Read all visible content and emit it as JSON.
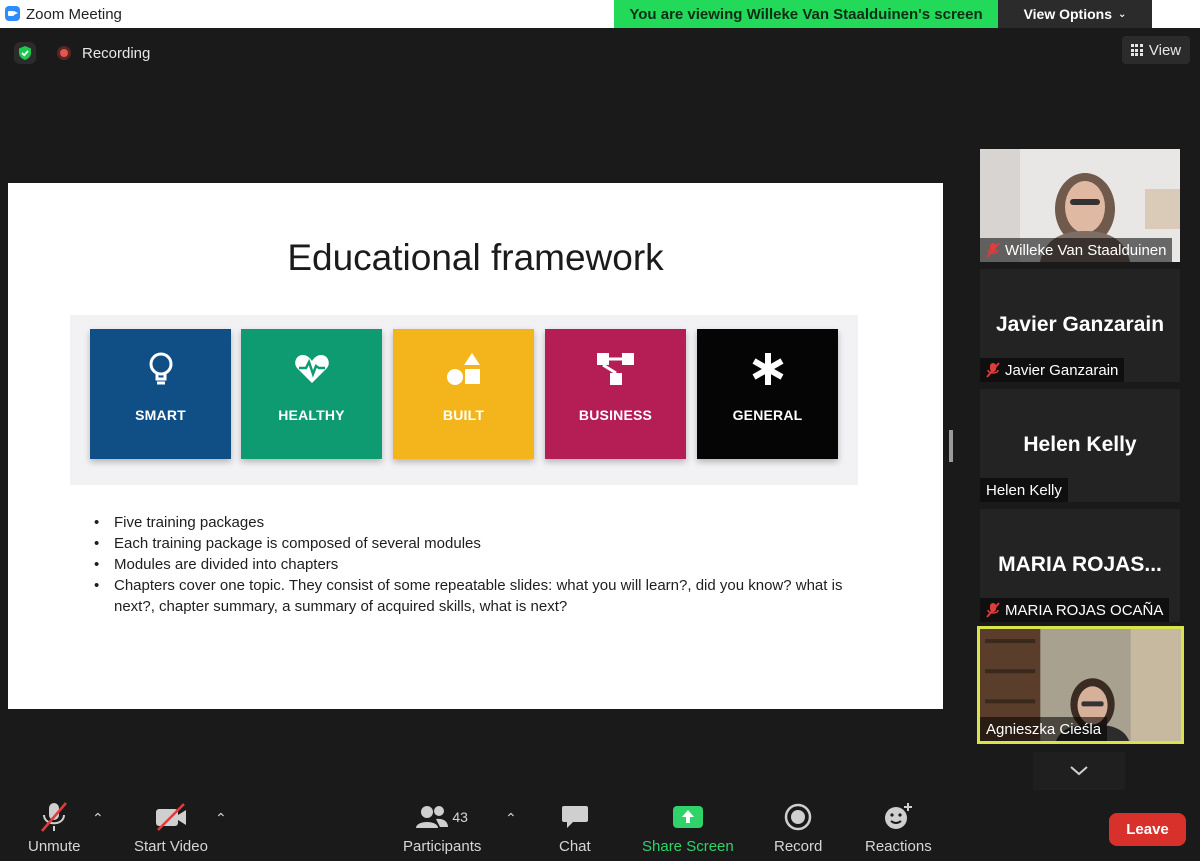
{
  "window": {
    "title": "Zoom Meeting"
  },
  "banner": {
    "viewing_text": "You are viewing Willeke Van Staalduinen's screen",
    "view_options_label": "View Options"
  },
  "status": {
    "recording_label": "Recording",
    "view_label": "View"
  },
  "slide": {
    "title": "Educational framework",
    "cards": [
      {
        "label": "SMART",
        "icon": "lightbulb-icon",
        "color": "#0f4f86"
      },
      {
        "label": "HEALTHY",
        "icon": "heart-pulse-icon",
        "color": "#0f9b72"
      },
      {
        "label": "BUILT",
        "icon": "shapes-icon",
        "color": "#f3b51b"
      },
      {
        "label": "BUSINESS",
        "icon": "org-chart-icon",
        "color": "#b51d55"
      },
      {
        "label": "GENERAL",
        "icon": "asterisk-icon",
        "color": "#050505"
      }
    ],
    "bullets": [
      "Five training packages",
      "Each training package is composed of several modules",
      "Modules are divided into chapters",
      "Chapters cover one topic. They consist of some repeatable slides: what you will learn?, did you know? what is next?, chapter summary, a summary of acquired skills, what is next?"
    ]
  },
  "participants": [
    {
      "name": "Willeke Van Staalduinen",
      "display": "",
      "muted": true,
      "video": true
    },
    {
      "name": "Javier Ganzarain",
      "display": "Javier Ganzarain",
      "muted": true,
      "video": false
    },
    {
      "name": "Helen Kelly",
      "display": "Helen Kelly",
      "muted": false,
      "video": false
    },
    {
      "name": "MARIA ROJAS OCAÑA",
      "display": "MARIA  ROJAS...",
      "muted": true,
      "video": false
    },
    {
      "name": "Agnieszka Cieśla",
      "display": "",
      "muted": false,
      "video": true,
      "active": true
    }
  ],
  "toolbar": {
    "unmute_label": "Unmute",
    "start_video_label": "Start Video",
    "participants_label": "Participants",
    "participants_count": "43",
    "chat_label": "Chat",
    "share_screen_label": "Share Screen",
    "record_label": "Record",
    "reactions_label": "Reactions",
    "leave_label": "Leave"
  },
  "colors": {
    "share_green": "#2fd36a",
    "banner_green": "#23d95a",
    "leave_red": "#d8312b",
    "active_speaker": "#d9e44b"
  }
}
